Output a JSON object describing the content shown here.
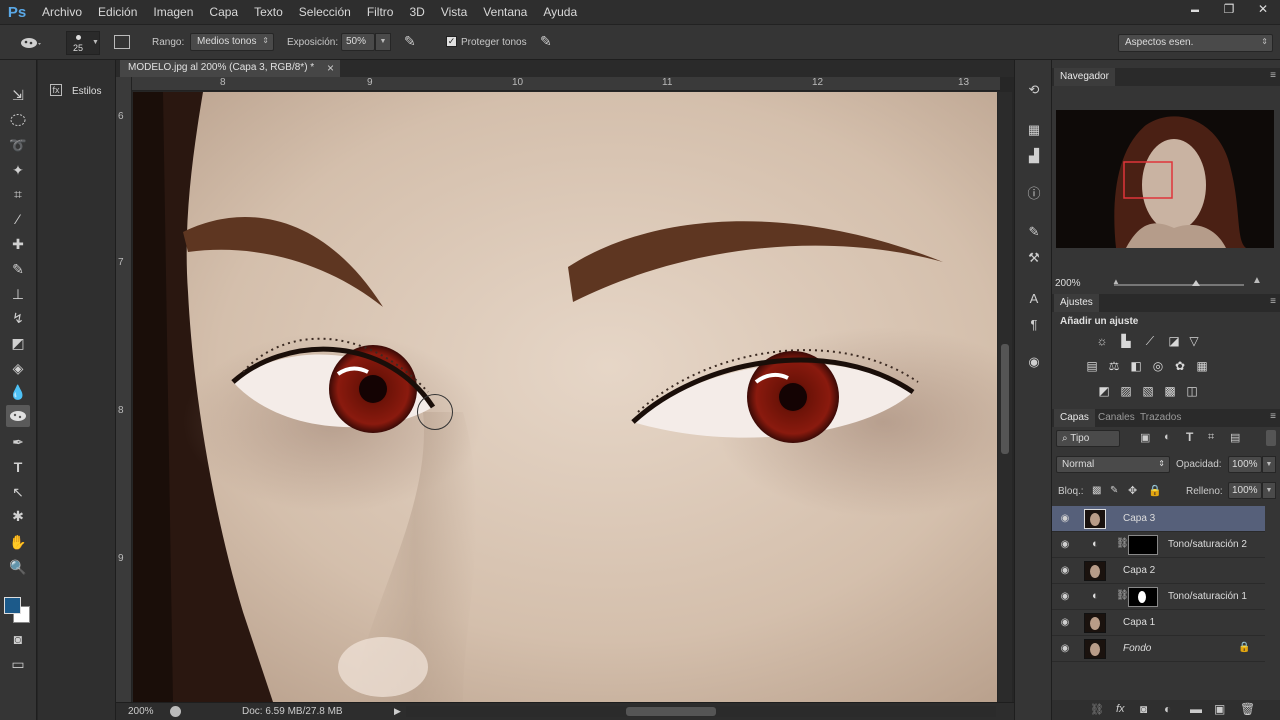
{
  "app": {
    "logo": "Ps"
  },
  "menu": [
    "Archivo",
    "Edición",
    "Imagen",
    "Capa",
    "Texto",
    "Selección",
    "Filtro",
    "3D",
    "Vista",
    "Ventana",
    "Ayuda"
  ],
  "window_controls": {
    "minimize": "▬",
    "restore": "❐",
    "close": "✕"
  },
  "options": {
    "brush_size": "25",
    "rango_label": "Rango:",
    "rango_value": "Medios tonos",
    "exposicion_label": "Exposición:",
    "exposicion_value": "50%",
    "proteger_label": "Proteger tonos",
    "proteger_checked": true,
    "workspace": "Aspectos esen."
  },
  "styles_panel": {
    "label": "Estilos"
  },
  "document": {
    "tab_title": "MODELO.jpg al 200% (Capa 3, RGB/8*) *",
    "close_glyph": "×",
    "ruler_top": [
      "8",
      "9",
      "10",
      "11",
      "12",
      "13"
    ],
    "ruler_left": [
      "6",
      "7",
      "8",
      "9"
    ]
  },
  "status": {
    "zoom": "200%",
    "doc_info": "Doc: 6.59 MB/27.8 MB"
  },
  "navigator": {
    "tab": "Navegador",
    "zoom": "200%"
  },
  "adjustments": {
    "tab": "Ajustes",
    "title": "Añadir un ajuste"
  },
  "layers_panel": {
    "tabs": [
      "Capas",
      "Canales",
      "Trazados"
    ],
    "filter": "Tipo",
    "blend_mode": "Normal",
    "opacity_label": "Opacidad:",
    "opacity_value": "100%",
    "lock_label": "Bloq.:",
    "fill_label": "Relleno:",
    "fill_value": "100%",
    "layers": [
      {
        "name": "Capa 3",
        "selected": true
      },
      {
        "name": "Tono/saturación 2",
        "adjustment": true
      },
      {
        "name": "Capa 2"
      },
      {
        "name": "Tono/saturación 1",
        "adjustment": true
      },
      {
        "name": "Capa 1"
      },
      {
        "name": "Fondo",
        "locked": true
      }
    ]
  },
  "colors": {
    "foreground": "#1c5a8a",
    "background": "#ffffff",
    "selected_layer": "#56607a",
    "eye_iris": "#8a1a0e"
  }
}
